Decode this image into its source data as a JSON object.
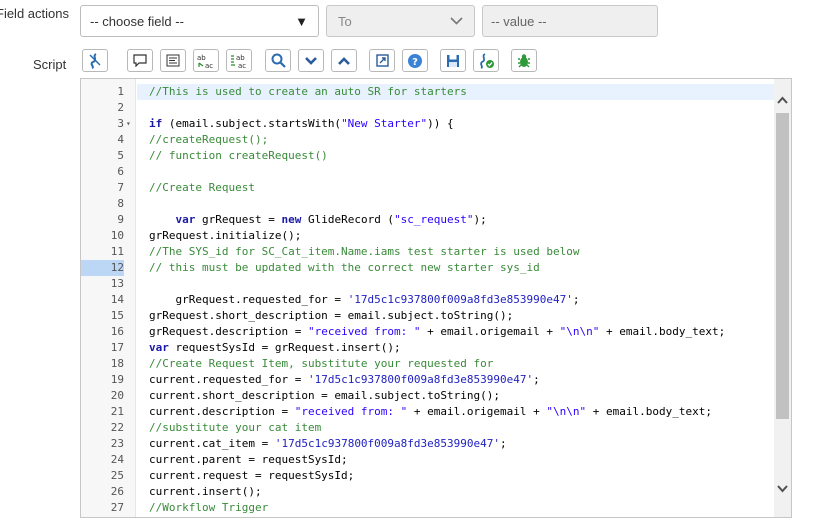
{
  "labels": {
    "field_actions": "Field actions",
    "script": "Script"
  },
  "field_actions": {
    "field_select": {
      "value": "-- choose field --"
    },
    "operator_select": {
      "value": "To"
    },
    "value_input": {
      "placeholder": "-- value --"
    }
  },
  "toolbar": [
    {
      "name": "toggle-syntax-editor-button",
      "icon": "script-toggle-icon"
    },
    {
      "name": "comment-selected-code-button",
      "icon": "comment-icon"
    },
    {
      "name": "format-code-button",
      "icon": "format-icon"
    },
    {
      "name": "replace-button",
      "icon": "replace-icon"
    },
    {
      "name": "replace-all-button",
      "icon": "replace-all-icon"
    },
    {
      "name": "search-button",
      "icon": "search-icon"
    },
    {
      "name": "fold-all-button",
      "icon": "chevron-down-icon"
    },
    {
      "name": "unfold-all-button",
      "icon": "chevron-up-icon"
    },
    {
      "name": "full-screen-button",
      "icon": "expand-icon"
    },
    {
      "name": "help-button",
      "icon": "help-icon"
    },
    {
      "name": "save-button",
      "icon": "save-icon"
    },
    {
      "name": "script-debugger-button",
      "icon": "debugger-icon"
    },
    {
      "name": "check-syntax-button",
      "icon": "bug-icon"
    }
  ],
  "editor": {
    "active_line": 1,
    "highlighted_line_number": 12,
    "lines": [
      {
        "n": "1",
        "fold": "",
        "tokens": [
          {
            "t": "//This is used to create an auto SR for starters",
            "c": "comment"
          }
        ]
      },
      {
        "n": "2",
        "fold": "",
        "tokens": []
      },
      {
        "n": "3",
        "fold": "▾",
        "tokens": [
          {
            "t": "if",
            "c": "kw"
          },
          {
            "t": " (email.subject.startsWith(",
            "c": ""
          },
          {
            "t": "\"New Starter\"",
            "c": "str"
          },
          {
            "t": ")) {",
            "c": ""
          }
        ]
      },
      {
        "n": "4",
        "fold": "",
        "tokens": [
          {
            "t": "//createRequest();",
            "c": "comment"
          }
        ]
      },
      {
        "n": "5",
        "fold": "",
        "tokens": [
          {
            "t": "// function createRequest()",
            "c": "comment"
          }
        ]
      },
      {
        "n": "6",
        "fold": "",
        "tokens": []
      },
      {
        "n": "7",
        "fold": "",
        "tokens": [
          {
            "t": "//Create Request",
            "c": "comment"
          }
        ]
      },
      {
        "n": "8",
        "fold": "",
        "tokens": []
      },
      {
        "n": "9",
        "fold": "",
        "tokens": [
          {
            "t": "    ",
            "c": ""
          },
          {
            "t": "var",
            "c": "kw"
          },
          {
            "t": " grRequest = ",
            "c": ""
          },
          {
            "t": "new",
            "c": "kw"
          },
          {
            "t": " GlideRecord (",
            "c": ""
          },
          {
            "t": "\"sc_request\"",
            "c": "str"
          },
          {
            "t": ");",
            "c": ""
          }
        ]
      },
      {
        "n": "10",
        "fold": "",
        "tokens": [
          {
            "t": "grRequest.initialize();",
            "c": ""
          }
        ]
      },
      {
        "n": "11",
        "fold": "",
        "tokens": [
          {
            "t": "//The SYS_id for SC_Cat_item.Name.iams test starter is used below",
            "c": "comment"
          }
        ]
      },
      {
        "n": "12",
        "fold": "",
        "tokens": [
          {
            "t": "// this must be updated with the correct new starter sys_id",
            "c": "comment"
          }
        ]
      },
      {
        "n": "13",
        "fold": "",
        "tokens": []
      },
      {
        "n": "14",
        "fold": "",
        "tokens": [
          {
            "t": "    grRequest.requested_for = ",
            "c": ""
          },
          {
            "t": "'17d5c1c937800f009a8fd3e853990e47'",
            "c": "str2"
          },
          {
            "t": ";",
            "c": ""
          }
        ]
      },
      {
        "n": "15",
        "fold": "",
        "tokens": [
          {
            "t": "grRequest.short_description = email.subject.toString();",
            "c": ""
          }
        ]
      },
      {
        "n": "16",
        "fold": "",
        "tokens": [
          {
            "t": "grRequest.description = ",
            "c": ""
          },
          {
            "t": "\"received from: \"",
            "c": "str"
          },
          {
            "t": " + email.origemail + ",
            "c": ""
          },
          {
            "t": "\"\\n\\n\"",
            "c": "str"
          },
          {
            "t": " + email.body_text;",
            "c": ""
          }
        ]
      },
      {
        "n": "17",
        "fold": "",
        "tokens": [
          {
            "t": "var",
            "c": "kw"
          },
          {
            "t": " requestSysId = grRequest.insert();",
            "c": ""
          }
        ]
      },
      {
        "n": "18",
        "fold": "",
        "tokens": [
          {
            "t": "//Create Request Item, substitute your requested for",
            "c": "comment"
          }
        ]
      },
      {
        "n": "19",
        "fold": "",
        "tokens": [
          {
            "t": "current.requested_for = ",
            "c": ""
          },
          {
            "t": "'17d5c1c937800f009a8fd3e853990e47'",
            "c": "str2"
          },
          {
            "t": ";",
            "c": ""
          }
        ]
      },
      {
        "n": "20",
        "fold": "",
        "tokens": [
          {
            "t": "current.short_description = email.subject.toString();",
            "c": ""
          }
        ]
      },
      {
        "n": "21",
        "fold": "",
        "tokens": [
          {
            "t": "current.description = ",
            "c": ""
          },
          {
            "t": "\"received from: \"",
            "c": "str"
          },
          {
            "t": " + email.origemail + ",
            "c": ""
          },
          {
            "t": "\"\\n\\n\"",
            "c": "str"
          },
          {
            "t": " + email.body_text;",
            "c": ""
          }
        ]
      },
      {
        "n": "22",
        "fold": "",
        "tokens": [
          {
            "t": "//substitute your cat item",
            "c": "comment"
          }
        ]
      },
      {
        "n": "23",
        "fold": "",
        "tokens": [
          {
            "t": "current.cat_item = ",
            "c": ""
          },
          {
            "t": "'17d5c1c937800f009a8fd3e853990e47'",
            "c": "str2"
          },
          {
            "t": ";",
            "c": ""
          }
        ]
      },
      {
        "n": "24",
        "fold": "",
        "tokens": [
          {
            "t": "current.parent = requestSysId;",
            "c": ""
          }
        ]
      },
      {
        "n": "25",
        "fold": "",
        "tokens": [
          {
            "t": "current.request = requestSysId;",
            "c": ""
          }
        ]
      },
      {
        "n": "26",
        "fold": "",
        "tokens": [
          {
            "t": "current.insert();",
            "c": ""
          }
        ]
      },
      {
        "n": "27",
        "fold": "",
        "tokens": [
          {
            "t": "//Workflow Trigger",
            "c": "comment"
          }
        ]
      }
    ]
  }
}
